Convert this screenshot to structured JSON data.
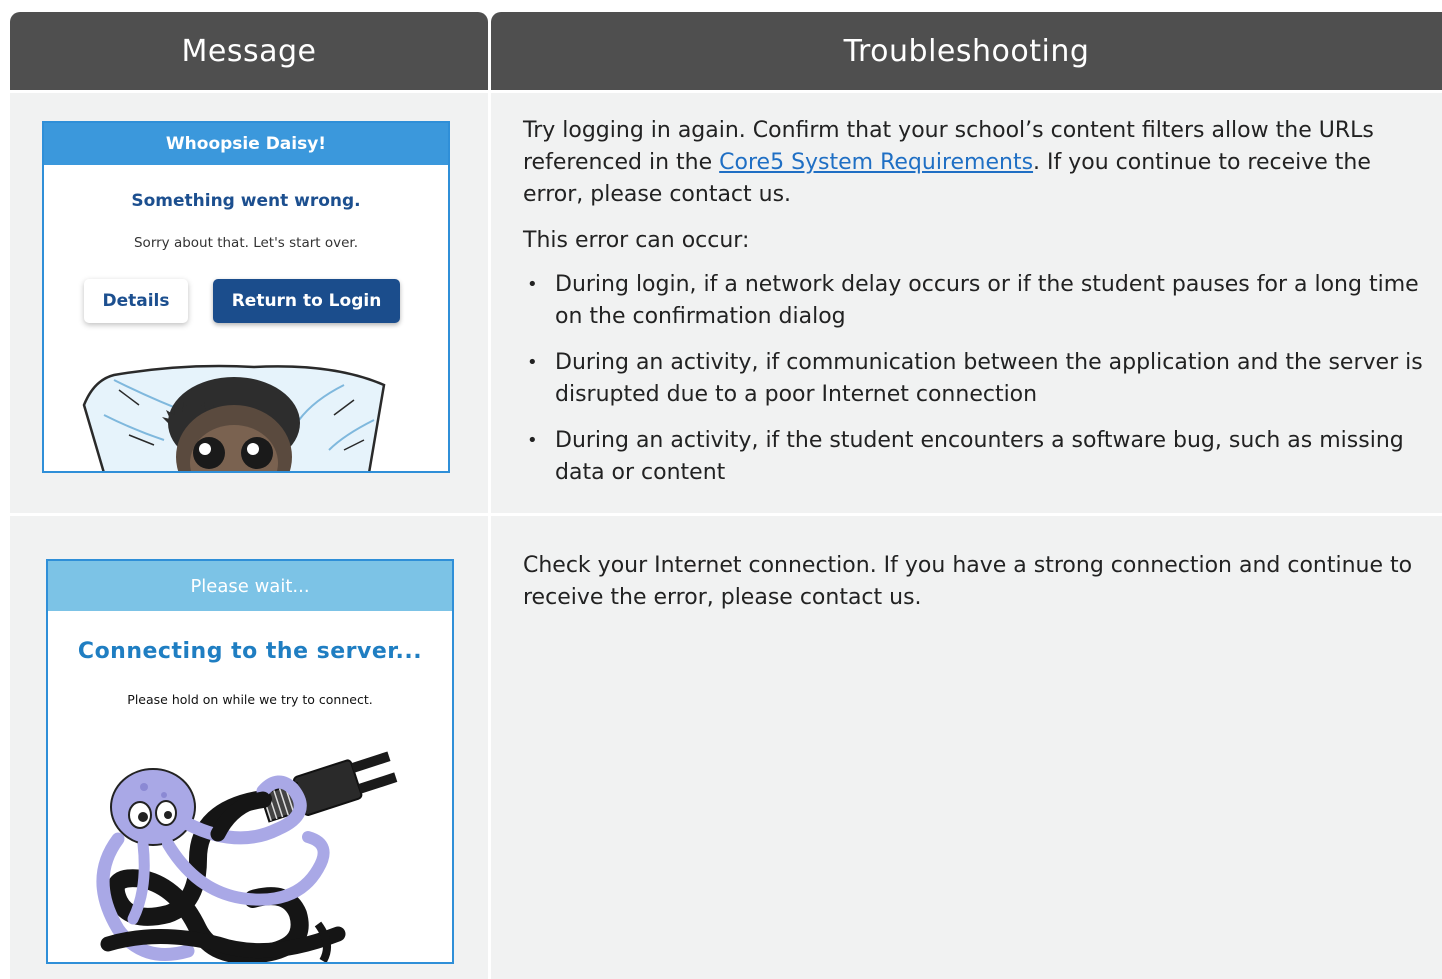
{
  "table": {
    "headers": {
      "message": "Message",
      "troubleshooting": "Troubleshooting"
    }
  },
  "row1": {
    "dialog": {
      "title": "Whoopsie Daisy!",
      "heading": "Something went wrong.",
      "subtext": "Sorry about that.  Let's start over.",
      "details_button": "Details",
      "return_button": "Return to Login",
      "illustration": "peeking-monkey-illustration"
    },
    "troubleshooting": {
      "intro_before_link": "Try logging in again. Confirm that your school’s content filters allow the URLs referenced in the ",
      "link_text": "Core5 System Requirements",
      "intro_after_link": ". If you continue to receive the error, please contact us.",
      "occur_label": "This error can occur:",
      "bullets": [
        "During login, if a network delay occurs or if the student pauses for a long time on the confirmation dialog",
        "During an activity, if communication between the application and the server is disrupted due to a poor Internet connection",
        "During an activity, if the student encounters a software bug, such as missing data or content"
      ]
    }
  },
  "row2": {
    "dialog": {
      "title": "Please wait...",
      "heading": "Connecting to the server...",
      "subtext": "Please hold on while we try to connect.",
      "illustration": "octopus-plug-illustration"
    },
    "troubleshooting": {
      "text": "Check your Internet connection. If you have a strong connection and continue to receive the error, please contact us."
    }
  },
  "colors": {
    "header_bg": "#4f4f4f",
    "cell_bg": "#f1f2f2",
    "link": "#1f6fc4",
    "dialog_bar_blue": "#3b98dc",
    "dialog_bar_lightblue": "#7cc3e6",
    "button_navy": "#1b4d8c"
  }
}
